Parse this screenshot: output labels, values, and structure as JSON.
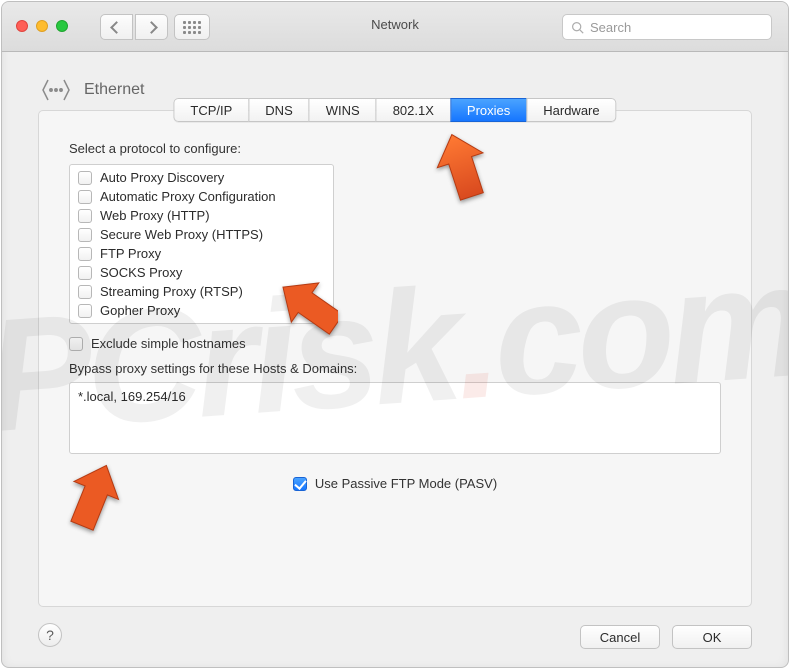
{
  "window": {
    "title": "Network"
  },
  "search": {
    "placeholder": "Search"
  },
  "header": {
    "interface": "Ethernet"
  },
  "tabs": [
    {
      "label": "TCP/IP",
      "active": false
    },
    {
      "label": "DNS",
      "active": false
    },
    {
      "label": "WINS",
      "active": false
    },
    {
      "label": "802.1X",
      "active": false
    },
    {
      "label": "Proxies",
      "active": true
    },
    {
      "label": "Hardware",
      "active": false
    }
  ],
  "proxies": {
    "select_label": "Select a protocol to configure:",
    "protocols": [
      {
        "label": "Auto Proxy Discovery",
        "checked": false
      },
      {
        "label": "Automatic Proxy Configuration",
        "checked": false
      },
      {
        "label": "Web Proxy (HTTP)",
        "checked": false
      },
      {
        "label": "Secure Web Proxy (HTTPS)",
        "checked": false
      },
      {
        "label": "FTP Proxy",
        "checked": false
      },
      {
        "label": "SOCKS Proxy",
        "checked": false
      },
      {
        "label": "Streaming Proxy (RTSP)",
        "checked": false
      },
      {
        "label": "Gopher Proxy",
        "checked": false
      }
    ],
    "exclude_label": "Exclude simple hostnames",
    "exclude_checked": false,
    "bypass_label": "Bypass proxy settings for these Hosts & Domains:",
    "bypass_value": "*.local, 169.254/16",
    "pasv_label": "Use Passive FTP Mode (PASV)",
    "pasv_checked": true
  },
  "buttons": {
    "help": "?",
    "cancel": "Cancel",
    "ok": "OK"
  },
  "watermark": {
    "text_before": "PCrisk",
    "dot": ".",
    "text_after": "com"
  }
}
